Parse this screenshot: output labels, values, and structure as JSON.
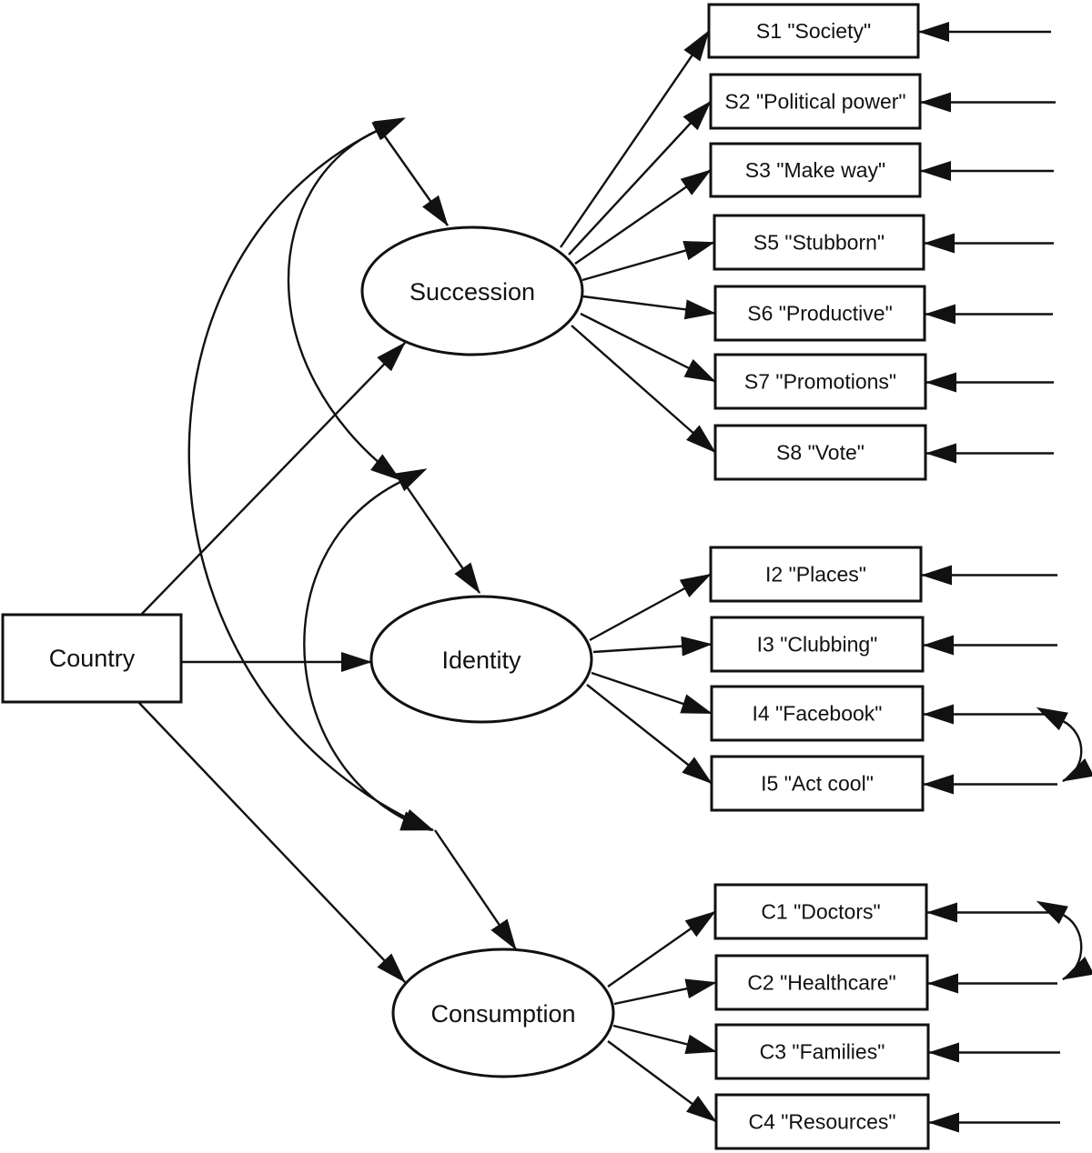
{
  "diagram": {
    "type": "structural-equation-model",
    "exogenous": {
      "id": "country",
      "label": "Country"
    },
    "latents": [
      {
        "id": "succession",
        "label": "Succession"
      },
      {
        "id": "identity",
        "label": "Identity"
      },
      {
        "id": "consumption",
        "label": "Consumption"
      }
    ],
    "indicators": [
      {
        "id": "S1",
        "label": "S1 \"Society\"",
        "factor": "succession"
      },
      {
        "id": "S2",
        "label": "S2 \"Political power\"",
        "factor": "succession"
      },
      {
        "id": "S3",
        "label": "S3 \"Make way\"",
        "factor": "succession"
      },
      {
        "id": "S5",
        "label": "S5 \"Stubborn\"",
        "factor": "succession"
      },
      {
        "id": "S6",
        "label": "S6 \"Productive\"",
        "factor": "succession"
      },
      {
        "id": "S7",
        "label": "S7 \"Promotions\"",
        "factor": "succession"
      },
      {
        "id": "S8",
        "label": "S8 \"Vote\"",
        "factor": "succession"
      },
      {
        "id": "I2",
        "label": "I2 \"Places\"",
        "factor": "identity"
      },
      {
        "id": "I3",
        "label": "I3 \"Clubbing\"",
        "factor": "identity"
      },
      {
        "id": "I4",
        "label": "I4 \"Facebook\"",
        "factor": "identity"
      },
      {
        "id": "I5",
        "label": "I5 \"Act cool\"",
        "factor": "identity"
      },
      {
        "id": "C1",
        "label": "C1 \"Doctors\"",
        "factor": "consumption"
      },
      {
        "id": "C2",
        "label": "C2 \"Healthcare\"",
        "factor": "consumption"
      },
      {
        "id": "C3",
        "label": "C3 \"Families\"",
        "factor": "consumption"
      },
      {
        "id": "C4",
        "label": "C4 \"Resources\"",
        "factor": "consumption"
      }
    ],
    "regressions": [
      {
        "from": "country",
        "to": "succession"
      },
      {
        "from": "country",
        "to": "identity"
      },
      {
        "from": "country",
        "to": "consumption"
      }
    ],
    "latent_residuals": [
      "succession",
      "identity",
      "consumption"
    ],
    "residual_covariances": [
      [
        "succession",
        "identity"
      ],
      [
        "succession",
        "consumption"
      ],
      [
        "identity",
        "consumption"
      ]
    ],
    "error_covariances": [
      [
        "I4",
        "I5"
      ],
      [
        "C1",
        "C2"
      ]
    ]
  }
}
